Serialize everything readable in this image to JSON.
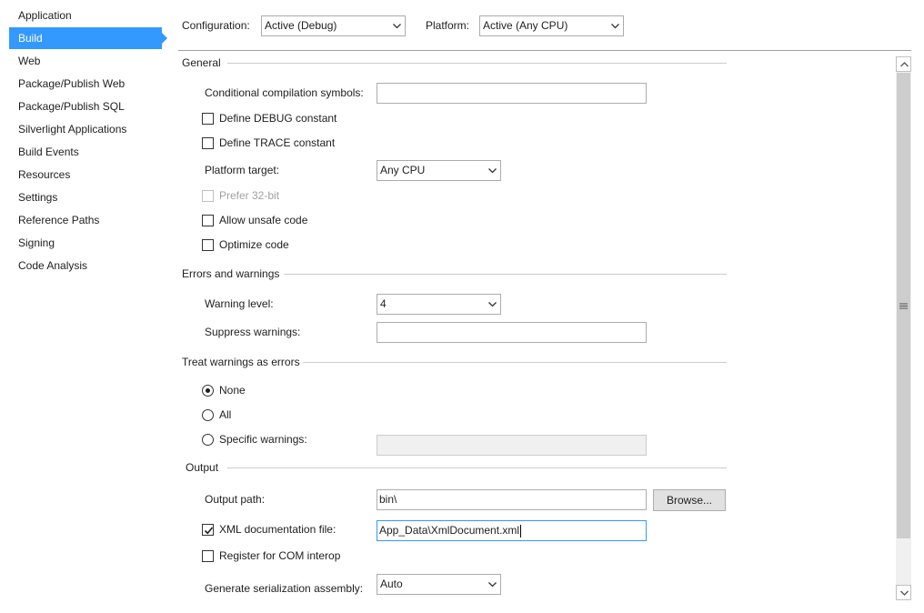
{
  "sidebar": {
    "items": [
      {
        "label": "Application",
        "selected": false
      },
      {
        "label": "Build",
        "selected": true
      },
      {
        "label": "Web",
        "selected": false
      },
      {
        "label": "Package/Publish Web",
        "selected": false
      },
      {
        "label": "Package/Publish SQL",
        "selected": false
      },
      {
        "label": "Silverlight Applications",
        "selected": false
      },
      {
        "label": "Build Events",
        "selected": false
      },
      {
        "label": "Resources",
        "selected": false
      },
      {
        "label": "Settings",
        "selected": false
      },
      {
        "label": "Reference Paths",
        "selected": false
      },
      {
        "label": "Signing",
        "selected": false
      },
      {
        "label": "Code Analysis",
        "selected": false
      }
    ]
  },
  "topbar": {
    "configuration_label": "Configuration:",
    "configuration_value": "Active (Debug)",
    "platform_label": "Platform:",
    "platform_value": "Active (Any CPU)"
  },
  "general": {
    "heading": "General",
    "symbols_label": "Conditional compilation symbols:",
    "symbols_value": "",
    "define_debug_label": "Define DEBUG constant",
    "define_debug_checked": false,
    "define_trace_label": "Define TRACE constant",
    "define_trace_checked": false,
    "platform_target_label": "Platform target:",
    "platform_target_value": "Any CPU",
    "prefer32_label": "Prefer 32-bit",
    "prefer32_checked": false,
    "unsafe_label": "Allow unsafe code",
    "unsafe_checked": false,
    "optimize_label": "Optimize code",
    "optimize_checked": false
  },
  "errors": {
    "heading": "Errors and warnings",
    "warning_level_label": "Warning level:",
    "warning_level_value": "4",
    "suppress_label": "Suppress warnings:",
    "suppress_value": ""
  },
  "treat": {
    "heading": "Treat warnings as errors",
    "none_label": "None",
    "all_label": "All",
    "specific_label": "Specific warnings:",
    "specific_value": "",
    "selected": "None"
  },
  "output": {
    "heading": "Output",
    "path_label": "Output path:",
    "path_value": "bin\\",
    "browse_label": "Browse...",
    "xml_label": "XML documentation file:",
    "xml_checked": true,
    "xml_value": "App_Data\\XmlDocument.xml",
    "com_label": "Register for COM interop",
    "com_checked": false,
    "serialization_label": "Generate serialization assembly:",
    "serialization_value": "Auto"
  },
  "colors": {
    "accent": "#3399ff",
    "section_line": "#cccccc",
    "disabled_text": "#a0a0a0"
  }
}
